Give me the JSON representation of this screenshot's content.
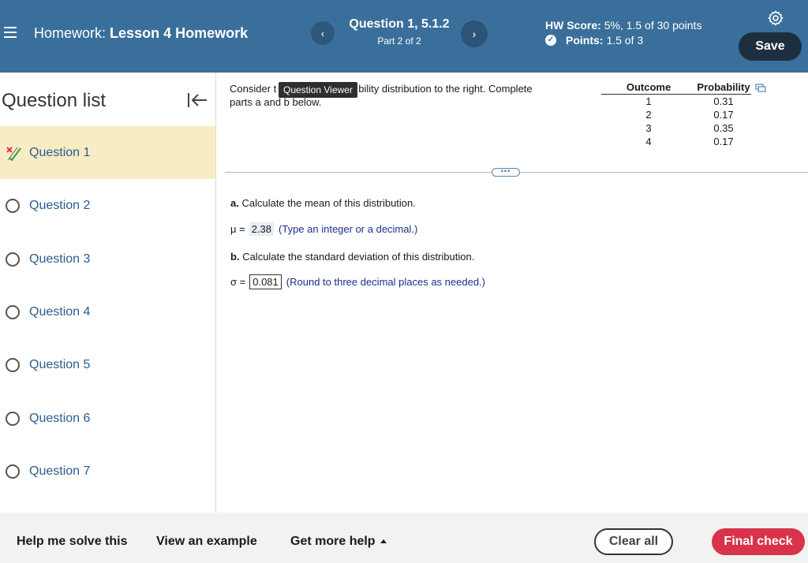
{
  "header": {
    "title_prefix": "Homework:",
    "title_name": "Lesson 4 Homework",
    "prev_label": "‹",
    "next_label": "›",
    "question_title": "Question 1, 5.1.2",
    "question_part": "Part 2 of 2",
    "hw_score_label": "HW Score:",
    "hw_score_value": "5%, 1.5 of 30 points",
    "points_label": "Points:",
    "points_value": "1.5 of 3",
    "save_label": "Save"
  },
  "sidebar": {
    "title": "Question list",
    "items": [
      {
        "label": "Question 1",
        "status": "partial"
      },
      {
        "label": "Question 2",
        "status": "unanswered"
      },
      {
        "label": "Question 3",
        "status": "unanswered"
      },
      {
        "label": "Question 4",
        "status": "unanswered"
      },
      {
        "label": "Question 5",
        "status": "unanswered"
      },
      {
        "label": "Question 6",
        "status": "unanswered"
      },
      {
        "label": "Question 7",
        "status": "unanswered"
      }
    ]
  },
  "content": {
    "intro_start": "Consider t",
    "intro_end": "bility distribution to the right. Complete parts a and b below.",
    "tooltip": "Question Viewer",
    "table": {
      "headers": [
        "Outcome",
        "Probability"
      ],
      "rows": [
        [
          "1",
          "0.31"
        ],
        [
          "2",
          "0.17"
        ],
        [
          "3",
          "0.35"
        ],
        [
          "4",
          "0.17"
        ]
      ]
    },
    "expand_label": "•••",
    "part_a_letter": "a.",
    "part_a_text": "Calculate the mean of this distribution.",
    "mu_symbol": "μ =",
    "mu_value": "2.38",
    "mu_hint": "(Type an integer or a decimal.)",
    "part_b_letter": "b.",
    "part_b_text": "Calculate the standard deviation of this distribution.",
    "sigma_symbol": "σ =",
    "sigma_value": "0.081",
    "sigma_hint": "(Round to three decimal places as needed.)"
  },
  "footer": {
    "help_solve": "Help me solve this",
    "view_example": "View an example",
    "more_help": "Get more help",
    "clear_all": "Clear all",
    "final_check": "Final check"
  },
  "colors": {
    "header_bg": "#3b6f9b",
    "active_item_bg": "#f8ecc4",
    "final_check_bg": "#d9334b",
    "link_blue": "#2a5d8f"
  }
}
